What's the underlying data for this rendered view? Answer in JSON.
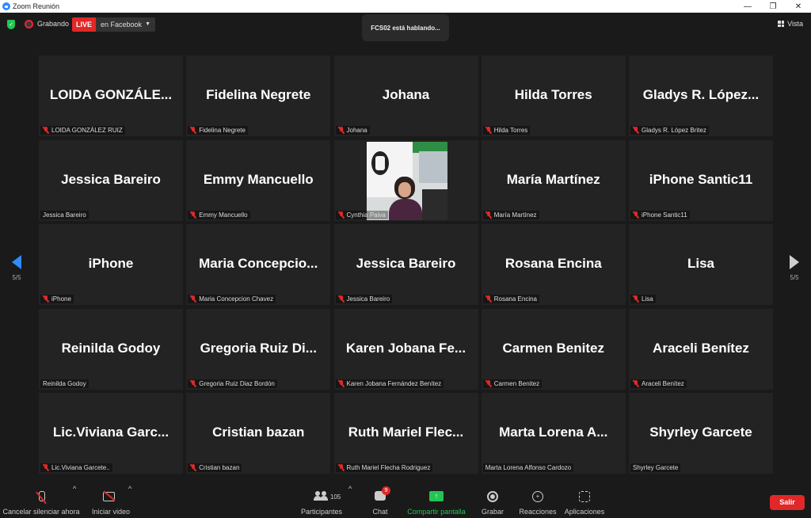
{
  "window": {
    "title": "Zoom Reunión",
    "minimize": "—",
    "maximize": "❐",
    "close": "✕"
  },
  "topbar": {
    "recording_label": "Grabando",
    "live_badge": "LIVE",
    "live_destination": "en Facebook",
    "speaker_status": "FCS02 está hablando...",
    "view_label": "Vista"
  },
  "pagination": {
    "left_page": "5/5",
    "right_page": "5/5"
  },
  "participants": [
    {
      "display": "LOIDA  GONZÁLE...",
      "name": "LOIDA GONZÁLEZ RUIZ",
      "muted": true
    },
    {
      "display": "Fidelina Negrete",
      "name": "Fidelina Negrete",
      "muted": true
    },
    {
      "display": "Johana",
      "name": "Johana",
      "muted": true
    },
    {
      "display": "Hilda Torres",
      "name": "Hilda Torres",
      "muted": true
    },
    {
      "display": "Gladys  R.  López...",
      "name": "Gladys R. López Britez",
      "muted": true
    },
    {
      "display": "Jessica Bareiro",
      "name": "Jessica Bareiro",
      "muted": false
    },
    {
      "display": "Emmy Mancuello",
      "name": "Emmy Mancuello",
      "muted": true
    },
    {
      "display": "",
      "name": "Cynthia Paiva",
      "muted": true,
      "video": true
    },
    {
      "display": "María Martínez",
      "name": "María Martínez",
      "muted": true
    },
    {
      "display": "iPhone Santic11",
      "name": "iPhone Santic11",
      "muted": true
    },
    {
      "display": "iPhone",
      "name": "iPhone",
      "muted": true
    },
    {
      "display": "Maria  Concepcio...",
      "name": "Maria Concepcion Chavez",
      "muted": true
    },
    {
      "display": "Jessica Bareiro",
      "name": "Jessica Bareiro",
      "muted": true
    },
    {
      "display": "Rosana Encina",
      "name": "Rosana Encina",
      "muted": true
    },
    {
      "display": "Lisa",
      "name": "Lisa",
      "muted": true
    },
    {
      "display": "Reinilda Godoy",
      "name": "Reinilda Godoy",
      "muted": false
    },
    {
      "display": "Gregoria  Ruiz  Di...",
      "name": "Gregoria Ruiz Diaz Bordón",
      "muted": true
    },
    {
      "display": "Karen  Jobana  Fe...",
      "name": "Karen Jobana Fernández Benítez",
      "muted": true
    },
    {
      "display": "Carmen Benitez",
      "name": "Carmen Benitez",
      "muted": true
    },
    {
      "display": "Araceli Benítez",
      "name": "Araceli Benítez",
      "muted": true
    },
    {
      "display": "Lic.Viviana  Garc...",
      "name": "Lic.Viviana Garcete..",
      "muted": true
    },
    {
      "display": "Cristian bazan",
      "name": "Cristian bazan",
      "muted": true
    },
    {
      "display": "Ruth  Mariel  Flec...",
      "name": "Ruth Mariel Flecha Rodriguez",
      "muted": true
    },
    {
      "display": "Marta  Lorena   A...",
      "name": "Marta Lorena  Alfonso Cardozo",
      "muted": false
    },
    {
      "display": "Shyrley Garcete",
      "name": "Shyrley Garcete",
      "muted": false
    }
  ],
  "toolbar": {
    "mute_label": "Cancelar silenciar ahora",
    "video_label": "Iniciar video",
    "participants_label": "Participantes",
    "participants_count": "105",
    "chat_label": "Chat",
    "chat_badge": "9",
    "share_label": "Compartir pantalla",
    "share_glyph": "↑",
    "record_label": "Grabar",
    "reactions_label": "Reacciones",
    "reactions_glyph": "+",
    "apps_label": "Aplicaciones",
    "leave_label": "Salir",
    "chevron": "^"
  },
  "colors": {
    "accent": "#2d8cff",
    "live": "#e02828",
    "share": "#23c552",
    "tile": "#232323",
    "background": "#1a1a1a"
  }
}
